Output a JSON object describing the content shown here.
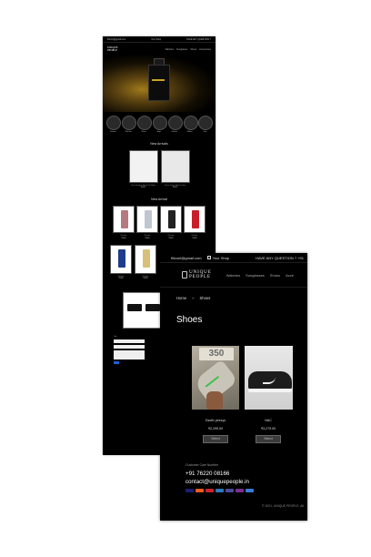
{
  "left_page": {
    "topbar": {
      "email": "fillcont@gmail.com",
      "shop": "Your Shop",
      "contact": "HAVE ANY QUESTION ?"
    },
    "nav": {
      "logo_line1": "UNIQUE",
      "logo_line2": "PEOPLE",
      "items": [
        "Watches",
        "Sunglasses",
        "Shoes",
        "Accessories"
      ]
    },
    "categories": [
      "Perfume",
      "Watches",
      "Shoes",
      "Bags",
      "Glasses",
      "Wallets",
      "Caps"
    ],
    "new_arrivals_title": "New Arrivals",
    "new_arrivals": [
      {
        "name": "Gucci Hombres Watch 140 Tables",
        "price": "₹4999"
      },
      {
        "name": "Classic Cartier Watch Leather",
        "price": "₹4999"
      }
    ],
    "new_arrival_title_2": "New Arrival",
    "perfumes": [
      {
        "name": "Perfume",
        "price": "₹2499"
      },
      {
        "name": "Perfume",
        "price": "₹2499"
      },
      {
        "name": "Perfume",
        "price": "₹2499"
      },
      {
        "name": "Perfume",
        "price": "₹2499"
      }
    ],
    "perfumes_2": [
      {
        "name": "Perfume",
        "price": "₹2499"
      },
      {
        "name": "Perfume",
        "price": "₹2499"
      }
    ],
    "form": {
      "title": "Your",
      "button": "Send"
    }
  },
  "topbar": {
    "email": "fillcont@gmail.com",
    "shop_label": "Your Shop",
    "question": "HAVE ANY QUESTION ? +91"
  },
  "header": {
    "logo_line1": "UNIQUE",
    "logo_line2": "PEOPLE",
    "menu": [
      "Watches",
      "Sunglasses",
      "Shoes",
      "Acce"
    ]
  },
  "breadcrumb": {
    "home": "Home",
    "separator": "»",
    "current": "Shoes"
  },
  "page_title": "Shoes",
  "products": [
    {
      "name": "Dsoflx yeezys",
      "price": "₹2,299.00",
      "button": "Select",
      "image": "yeezy-350-shoe"
    },
    {
      "name": "NAC",
      "price": "₹3,279.00",
      "button": "Select",
      "image": "nike-air-force-shoe"
    }
  ],
  "footer": {
    "support_label": "Customer Care Number",
    "phone": "+91 76220 08166",
    "email": "contact@uniquepeople.in",
    "payment_icons": [
      "visa",
      "mastercard",
      "maestro",
      "amex",
      "rupay",
      "paypal",
      "upi"
    ],
    "copyright": "© 2021, UNIQUE PEOPLE. All"
  },
  "colors": {
    "background": "#000000",
    "text": "#ffffff",
    "accent_gold": "#c9a227",
    "button_gray": "#3a3a3a"
  }
}
